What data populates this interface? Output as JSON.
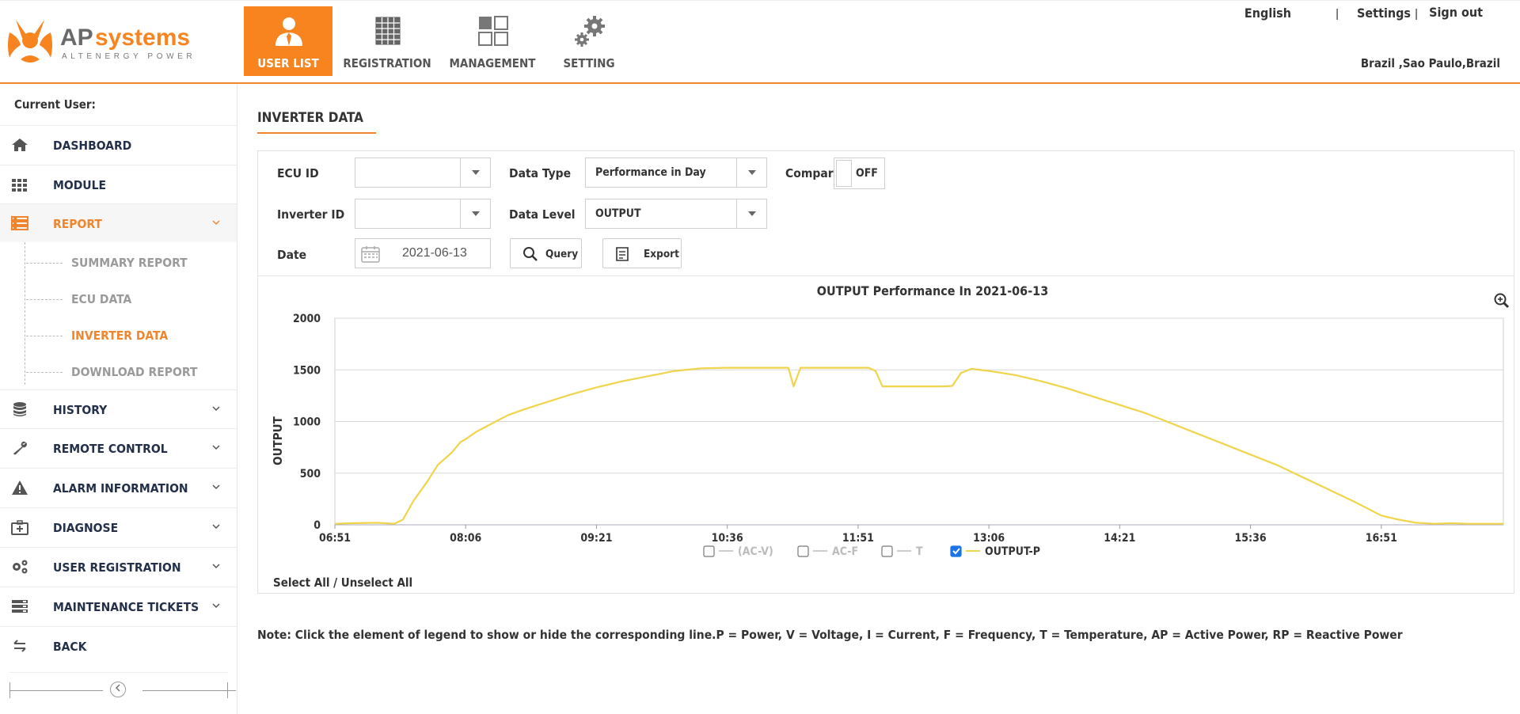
{
  "brand": {
    "name_ap": "AP",
    "name_systems": "systems",
    "tagline": "ALTENERGY POWER"
  },
  "nav": [
    {
      "label": "USER LIST",
      "icon": "user-tie-icon",
      "active": true
    },
    {
      "label": "REGISTRATION",
      "icon": "solar-panel-icon",
      "active": false
    },
    {
      "label": "MANAGEMENT",
      "icon": "grid-icon",
      "active": false
    },
    {
      "label": "SETTING",
      "icon": "gears-icon",
      "active": false
    }
  ],
  "top_links": {
    "language": "English",
    "sep": "|",
    "settings": "Settings",
    "sign_out": "Sign out"
  },
  "location": "Brazil ,Sao Paulo,Brazil",
  "sidebar": {
    "current_user_label": "Current User:",
    "items": [
      {
        "label": "DASHBOARD",
        "icon": "home-icon"
      },
      {
        "label": "MODULE",
        "icon": "grid-dots-icon"
      },
      {
        "label": "REPORT",
        "icon": "report-icon",
        "active": true
      },
      {
        "label": "HISTORY",
        "icon": "database-icon"
      },
      {
        "label": "REMOTE CONTROL",
        "icon": "wrench-icon"
      },
      {
        "label": "ALARM INFORMATION",
        "icon": "warning-icon"
      },
      {
        "label": "DIAGNOSE",
        "icon": "medkit-icon"
      },
      {
        "label": "USER REGISTRATION",
        "icon": "gears-icon"
      },
      {
        "label": "MAINTENANCE TICKETS",
        "icon": "server-icon"
      },
      {
        "label": "BACK",
        "icon": "back-arrow-icon"
      }
    ],
    "report_sub": [
      {
        "label": "SUMMARY REPORT"
      },
      {
        "label": "ECU DATA"
      },
      {
        "label": "INVERTER DATA",
        "active": true
      },
      {
        "label": "DOWNLOAD REPORT"
      }
    ]
  },
  "main": {
    "title": "INVERTER DATA",
    "filters": {
      "ecu_id_label": "ECU ID",
      "ecu_id_value": "",
      "data_type_label": "Data Type",
      "data_type_value": "Performance in Day",
      "compare_label": "Compare",
      "compare_state": "OFF",
      "inverter_id_label": "Inverter ID",
      "inverter_id_value": "",
      "data_level_label": "Data Level",
      "data_level_value": "OUTPUT",
      "date_label": "Date",
      "date_value": "2021-06-13",
      "query_label": "Query",
      "export_label": "Export"
    },
    "select_all_label": "Select All / Unselect All",
    "note": "Note: Click the element of legend to show or hide the corresponding line.P = Power, V = Voltage, I = Current, F = Frequency, T = Temperature, AP = Active Power, RP = Reactive Power"
  },
  "colors": {
    "accent": "#f7841f",
    "series": "#f0d44a",
    "nav_text": "#22304a"
  },
  "chart_data": {
    "type": "line",
    "title": "OUTPUT Performance In 2021-06-13",
    "ylabel": "OUTPUT",
    "xlabel": "",
    "ylim": [
      0,
      2000
    ],
    "yticks": [
      0,
      500,
      1000,
      1500,
      2000
    ],
    "x_range": [
      "06:51",
      "18:01"
    ],
    "xticks": [
      "06:51",
      "08:06",
      "09:21",
      "10:36",
      "11:51",
      "13:06",
      "14:21",
      "15:36",
      "16:51"
    ],
    "grid": true,
    "legend_position": "bottom",
    "legend": [
      {
        "name": "(AC-V)",
        "checked": false
      },
      {
        "name": "AC-F",
        "checked": false
      },
      {
        "name": "T",
        "checked": false
      },
      {
        "name": "OUTPUT-P",
        "checked": true
      }
    ],
    "series": [
      {
        "name": "OUTPUT-P",
        "x": [
          "06:51",
          "07:00",
          "07:15",
          "07:25",
          "07:30",
          "07:36",
          "07:44",
          "07:50",
          "07:58",
          "08:03",
          "08:06",
          "08:12",
          "08:21",
          "08:30",
          "08:40",
          "08:51",
          "09:06",
          "09:21",
          "09:36",
          "09:51",
          "10:06",
          "10:21",
          "10:36",
          "10:51",
          "11:06",
          "11:11",
          "11:14",
          "11:18",
          "11:30",
          "11:45",
          "11:57",
          "12:01",
          "12:05",
          "12:10",
          "12:20",
          "12:30",
          "12:40",
          "12:45",
          "12:50",
          "12:56",
          "13:06",
          "13:21",
          "13:36",
          "13:51",
          "14:06",
          "14:21",
          "14:36",
          "14:51",
          "15:06",
          "15:21",
          "15:36",
          "15:51",
          "16:06",
          "16:21",
          "16:36",
          "16:51",
          "17:01",
          "17:11",
          "17:21",
          "17:31",
          "17:41",
          "18:01"
        ],
        "y": [
          10,
          15,
          20,
          10,
          50,
          230,
          420,
          580,
          700,
          800,
          830,
          900,
          980,
          1060,
          1120,
          1180,
          1260,
          1330,
          1390,
          1440,
          1490,
          1515,
          1520,
          1520,
          1520,
          1520,
          1340,
          1520,
          1520,
          1520,
          1520,
          1490,
          1340,
          1340,
          1340,
          1340,
          1340,
          1345,
          1470,
          1510,
          1490,
          1450,
          1390,
          1320,
          1240,
          1160,
          1080,
          980,
          880,
          780,
          680,
          580,
          460,
          340,
          220,
          90,
          50,
          20,
          10,
          15,
          10,
          10
        ]
      }
    ]
  }
}
